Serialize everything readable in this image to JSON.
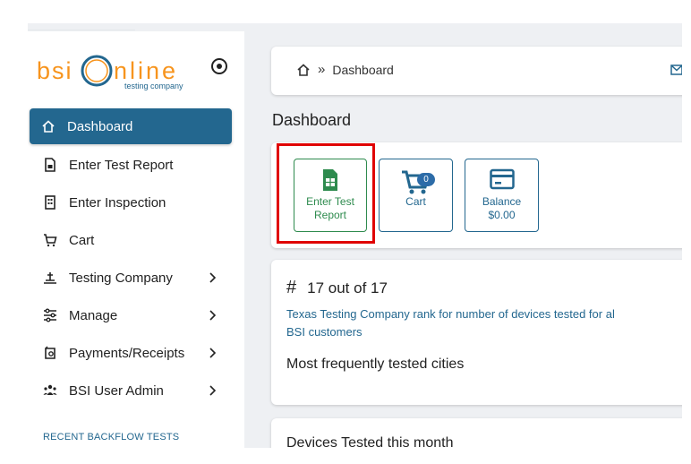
{
  "logo": {
    "text_left": "bsi",
    "text_right": "nline",
    "tagline": "testing company"
  },
  "sidebar": {
    "items": [
      {
        "label": "Dashboard"
      },
      {
        "label": "Enter Test Report"
      },
      {
        "label": "Enter Inspection"
      },
      {
        "label": "Cart"
      },
      {
        "label": "Testing Company"
      },
      {
        "label": "Manage"
      },
      {
        "label": "Payments/Receipts"
      },
      {
        "label": "BSI User Admin"
      }
    ],
    "recent_label": "RECENT BACKFLOW TESTS"
  },
  "breadcrumb": {
    "sep": "»",
    "current": "Dashboard"
  },
  "page_title": "Dashboard",
  "tiles": {
    "report_line1": "Enter Test",
    "report_line2": "Report",
    "cart_label": "Cart",
    "cart_count": "0",
    "balance_label": "Balance",
    "balance_value": "$0.00"
  },
  "rank": {
    "hash": "#",
    "title": "17 out of 17",
    "desc_line1": "Texas Testing Company rank for number of devices tested for al",
    "desc_line2": "BSI customers",
    "cities_heading": "Most frequently tested cities"
  },
  "devices_heading": "Devices Tested this month",
  "colors": {
    "accent": "#23678f",
    "green": "#2e8b4e",
    "highlight": "#e00000"
  }
}
